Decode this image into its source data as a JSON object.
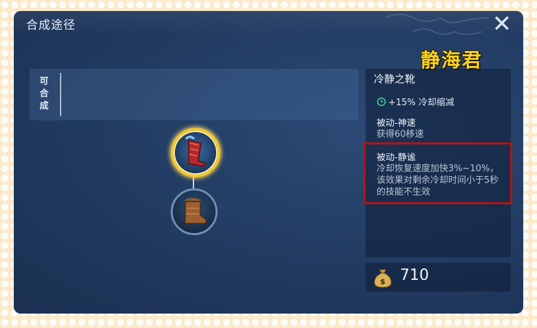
{
  "window": {
    "title": "合成途径",
    "close_label": "✕"
  },
  "hero_tag": "静海君",
  "craft": {
    "label": "可合成"
  },
  "item": {
    "name": "冷静之靴",
    "stat": "+15% 冷却缩减",
    "passives": [
      {
        "title": "被动-神速",
        "desc": "获得60移速"
      },
      {
        "title": "被动-静谧",
        "desc": "冷却恢复速度加快3%~10%，该效果对剩余冷却时间小于5秒的技能不生效"
      }
    ]
  },
  "price": {
    "value": "710"
  },
  "colors": {
    "highlight": "#b41414",
    "gold": "#f2c631",
    "hero_tag": "#ffd21a"
  },
  "icons": {
    "close": "close-icon",
    "cooldown": "cooldown-icon",
    "coin_bag": "coin-bag-icon",
    "main_item": "boots-of-calm-icon",
    "sub_item": "boots-icon"
  }
}
